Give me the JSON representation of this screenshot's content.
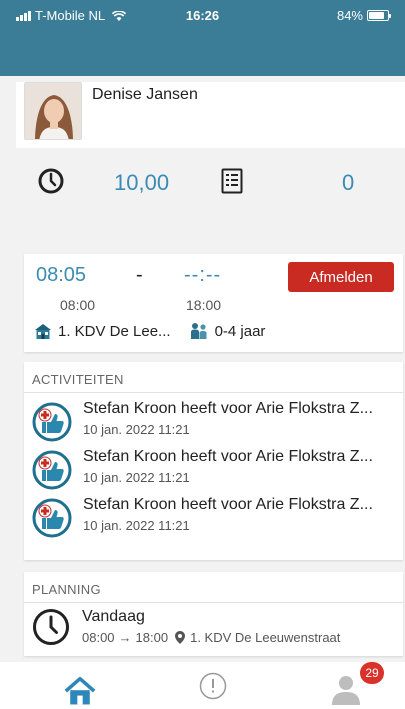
{
  "status_bar": {
    "carrier": "T-Mobile NL",
    "time": "16:26",
    "battery": "84%",
    "battery_level": 0.84
  },
  "profile": {
    "name": "Denise Jansen"
  },
  "stats": {
    "hours": "10,00",
    "count": "0"
  },
  "shift": {
    "clock_in": "08:05",
    "separator": "-",
    "clock_out": "--:--",
    "action_label": "Afmelden",
    "planned_start": "08:00",
    "planned_end": "18:00",
    "location": "1. KDV De Lee...",
    "group": "0-4 jaar"
  },
  "activities": {
    "title": "ACTIVITEITEN",
    "items": [
      {
        "text": "Stefan Kroon heeft voor Arie Flokstra Z...",
        "time": "10 jan. 2022 11:21"
      },
      {
        "text": "Stefan Kroon heeft voor Arie Flokstra Z...",
        "time": "10 jan. 2022 11:21"
      },
      {
        "text": "Stefan Kroon heeft voor Arie Flokstra Z...",
        "time": "10 jan. 2022 11:21"
      }
    ]
  },
  "planning": {
    "title": "PLANNING",
    "day": "Vandaag",
    "start": "08:00",
    "arrow": "→",
    "end": "18:00",
    "location": "1. KDV De Leeuwenstraat"
  },
  "tabbar": {
    "badge": "29"
  },
  "colors": {
    "header": "#3b7c97",
    "accent": "#3b8bb5",
    "danger": "#c92a22",
    "badge": "#d9322a"
  },
  "icons": [
    "signal-icon",
    "wifi-icon",
    "battery-icon",
    "clock-icon",
    "list-icon",
    "house-icon",
    "children-icon",
    "thumbs-up-medical-icon",
    "location-pin-icon",
    "home-tab-icon",
    "alert-tab-icon",
    "person-tab-icon"
  ]
}
